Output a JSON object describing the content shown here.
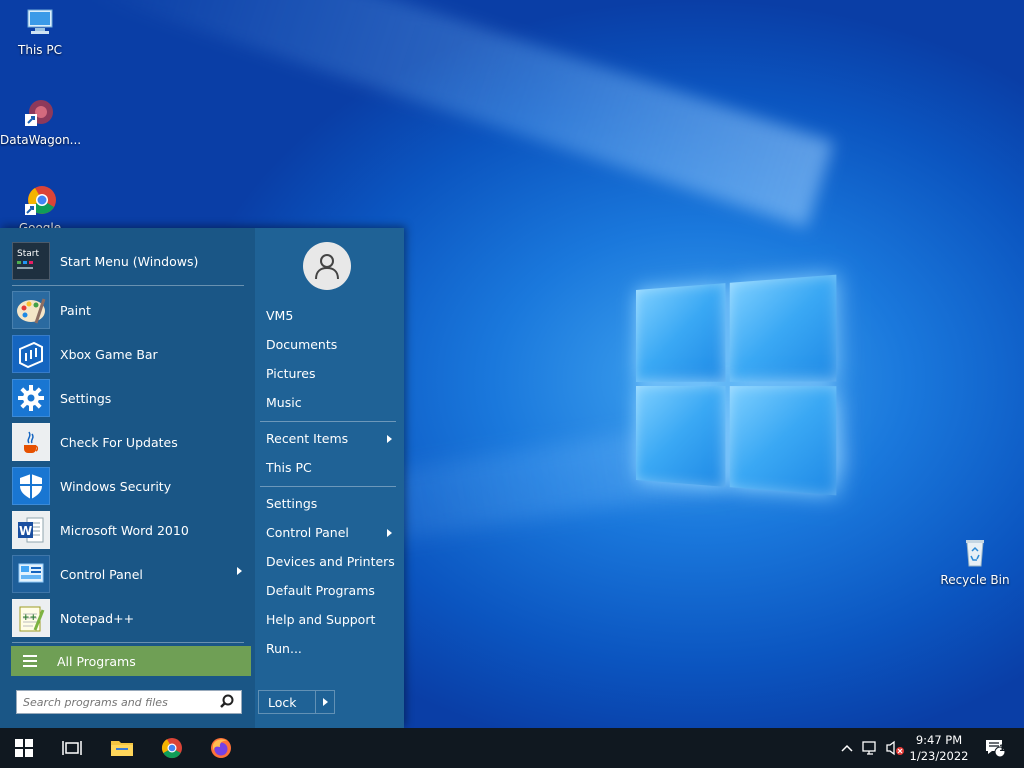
{
  "desktop": {
    "icons": [
      {
        "label": "This PC"
      },
      {
        "label": "DataWagon..."
      },
      {
        "label": "Google"
      },
      {
        "label": "Recycle Bin"
      }
    ]
  },
  "start_menu": {
    "programs": [
      {
        "label": "Start Menu (Windows)",
        "icon": "start-menu-icon"
      },
      {
        "label": "Paint",
        "icon": "paint-icon"
      },
      {
        "label": "Xbox Game Bar",
        "icon": "xbox-game-bar-icon"
      },
      {
        "label": "Settings",
        "icon": "gear-icon"
      },
      {
        "label": "Check For Updates",
        "icon": "java-icon"
      },
      {
        "label": "Windows Security",
        "icon": "shield-icon"
      },
      {
        "label": "Microsoft Word 2010",
        "icon": "word-icon"
      },
      {
        "label": "Control Panel",
        "icon": "control-panel-icon",
        "submenu": true
      },
      {
        "label": "Notepad++",
        "icon": "notepadpp-icon"
      }
    ],
    "all_programs_label": "All Programs",
    "search_placeholder": "Search programs and files",
    "right_items": [
      {
        "label": "VM5"
      },
      {
        "label": "Documents"
      },
      {
        "label": "Pictures"
      },
      {
        "label": "Music"
      },
      {
        "label": "Recent Items",
        "submenu": true
      },
      {
        "label": "This PC"
      },
      {
        "label": "Settings"
      },
      {
        "label": "Control Panel",
        "submenu": true
      },
      {
        "label": "Devices and Printers"
      },
      {
        "label": "Default Programs"
      },
      {
        "label": "Help and Support"
      },
      {
        "label": "Run..."
      }
    ],
    "lock_label": "Lock",
    "start_menu_icon_text": "Start"
  },
  "taskbar": {
    "time": "9:47 PM",
    "date": "1/23/2022",
    "notification_count": "1"
  },
  "colors": {
    "menu_left": "#1a5686",
    "menu_right": "#1f6296",
    "all_programs": "#6f9f55",
    "taskbar": "#101820"
  }
}
